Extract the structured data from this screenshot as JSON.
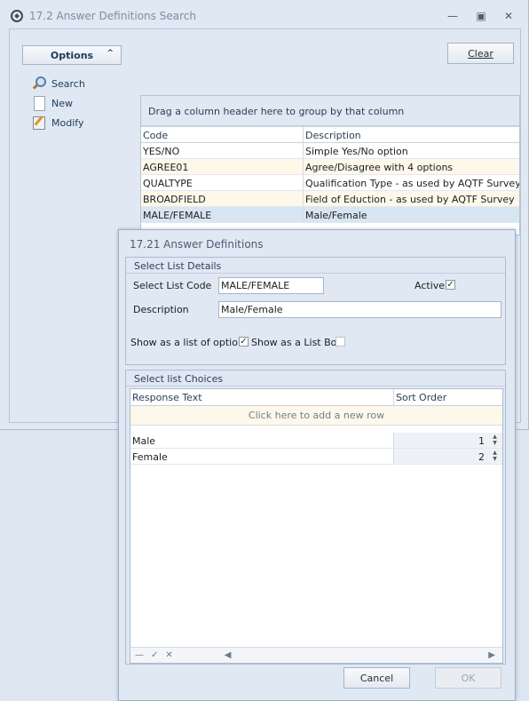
{
  "outer": {
    "title": "17.2 Answer Definitions Search",
    "minimize_icon": "minimize-icon",
    "restore_icon": "restore-icon",
    "close_icon": "close-icon",
    "options_label": "Options",
    "clear_label": "Clear",
    "side": [
      {
        "label": "Search",
        "icon": "search-icon"
      },
      {
        "label": "New",
        "icon": "new-document-icon"
      },
      {
        "label": "Modify",
        "icon": "modify-icon"
      }
    ],
    "grid": {
      "group_hint": "Drag a column header here to group by that column",
      "headers": [
        "Code",
        "Description"
      ],
      "rows": [
        {
          "code": "YES/NO",
          "desc": "Simple Yes/No option"
        },
        {
          "code": "AGREE01",
          "desc": "Agree/Disagree with 4 options"
        },
        {
          "code": "QUALTYPE",
          "desc": "Qualification Type - as used by AQTF Survey"
        },
        {
          "code": "BROADFIELD",
          "desc": "Field of Eduction - as used by AQTF Survey"
        },
        {
          "code": "MALE/FEMALE",
          "desc": "Male/Female"
        }
      ]
    }
  },
  "dialog": {
    "title": "17.21 Answer Definitions",
    "details": {
      "caption": "Select List Details",
      "code_label": "Select List Code",
      "code_value": "MALE/FEMALE",
      "active_label": "Active",
      "active_checked": true,
      "desc_label": "Description",
      "desc_value": "Male/Female",
      "options_label": "Show as a list of options",
      "options_checked": true,
      "listbox_label": "Show as a List Box",
      "listbox_checked": false
    },
    "choices": {
      "caption": "Select list Choices",
      "headers": [
        "Response Text",
        "Sort Order"
      ],
      "add_hint": "Click here to add a new row",
      "rows": [
        {
          "text": "Male",
          "order": "1"
        },
        {
          "text": "Female",
          "order": "2"
        }
      ]
    },
    "cancel_label": "Cancel",
    "ok_label": "OK"
  }
}
